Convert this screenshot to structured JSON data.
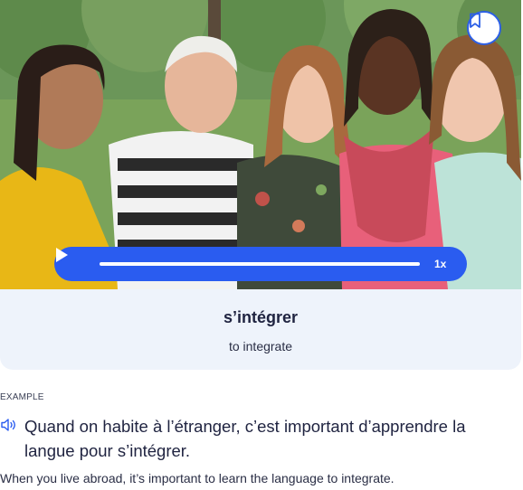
{
  "flashcard": {
    "image_alt": "five smiling women posing together outdoors",
    "bookmark_icon": "bookmark-icon",
    "audio_player": {
      "play_icon": "play-icon",
      "speed_label": "1x",
      "progress": 0.0
    },
    "word": "s’intégrer",
    "translation": "to integrate"
  },
  "example": {
    "label": "EXAMPLE",
    "speaker_icon": "speaker-icon",
    "sentence": "Quand on habite à l’étranger, c’est important d’apprendre la langue pour s’intégrer.",
    "translation": "When you live abroad, it’s important to learn the language to integrate."
  },
  "colors": {
    "accent": "#2a5cf0",
    "panel": "#eef3fb",
    "text": "#1f2340"
  }
}
